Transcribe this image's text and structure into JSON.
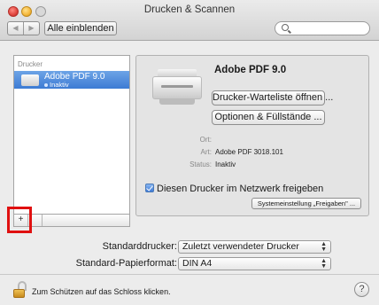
{
  "window": {
    "title": "Drucken & Scannen"
  },
  "toolbar": {
    "back_glyph": "◀",
    "forward_glyph": "▶",
    "show_all_label": "Alle einblenden",
    "search": {
      "placeholder": "",
      "value": ""
    }
  },
  "sidebar": {
    "header": "Drucker",
    "printers": [
      {
        "name": "Adobe PDF 9.0",
        "status": "Inaktiv",
        "selected": true
      }
    ],
    "add_label": "+",
    "highlight_color": "#e01010"
  },
  "detail": {
    "printer_name": "Adobe PDF 9.0",
    "queue_button": "Drucker-Warteliste öffnen ...",
    "options_button": "Optionen & Füllstände ...",
    "fields": {
      "location_label": "Ort:",
      "location_value": "",
      "kind_label": "Art:",
      "kind_value": "Adobe PDF 3018.101",
      "status_label": "Status:",
      "status_value": "Inaktiv"
    },
    "share_label": "Diesen Drucker im Netzwerk freigeben",
    "share_checked": true,
    "sharing_prefs_button": "Systemeinstellung „Freigaben\" ..."
  },
  "defaults": {
    "default_printer_label": "Standarddrucker:",
    "default_printer_value": "Zuletzt verwendeter Drucker",
    "paper_size_label": "Standard-Papierformat:",
    "paper_size_value": "DIN A4"
  },
  "footer": {
    "lock_text": "Zum Schützen auf das Schloss klicken.",
    "help_label": "?"
  },
  "colors": {
    "selection": "#3c7bd4",
    "accent_red": "#e01010"
  }
}
